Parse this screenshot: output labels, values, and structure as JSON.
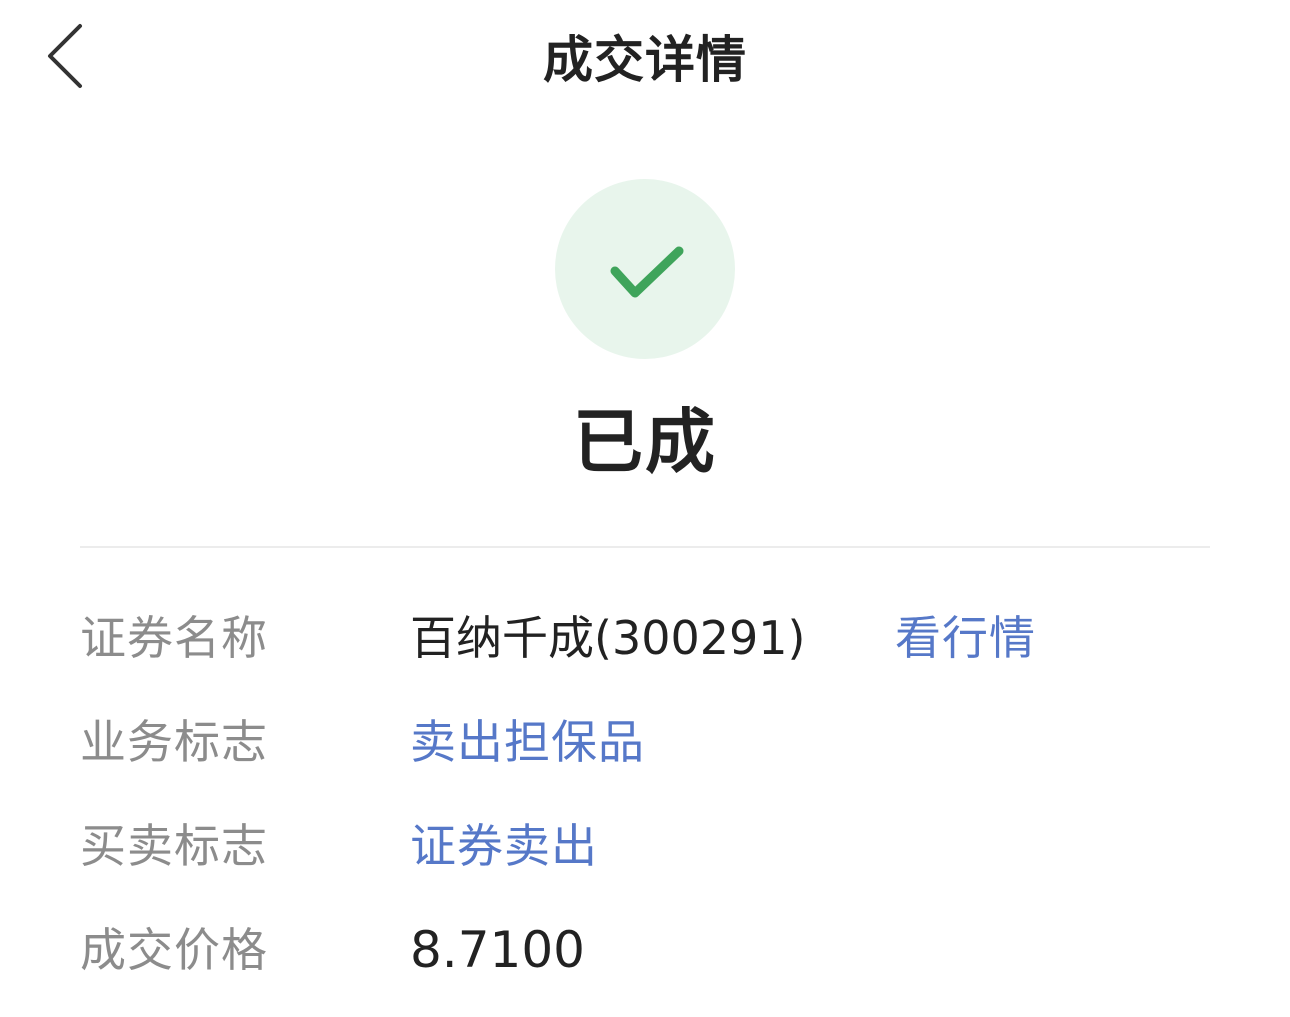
{
  "header": {
    "title": "成交详情",
    "back_icon": "chevron-left-icon"
  },
  "status": {
    "icon": "check-icon",
    "label": "已成",
    "accent_color": "#3fa45b",
    "circle_color": "#e8f5ec"
  },
  "details": {
    "security_name": {
      "label": "证券名称",
      "value": "百纳千成(300291)",
      "action": "看行情"
    },
    "business_flag": {
      "label": "业务标志",
      "value": "卖出担保品"
    },
    "trade_flag": {
      "label": "买卖标志",
      "value": "证券卖出"
    },
    "deal_price": {
      "label": "成交价格",
      "value": "8.7100"
    }
  },
  "colors": {
    "text_primary": "#222222",
    "text_secondary": "#8c8c8c",
    "link": "#5678c8",
    "divider": "#ececec"
  }
}
